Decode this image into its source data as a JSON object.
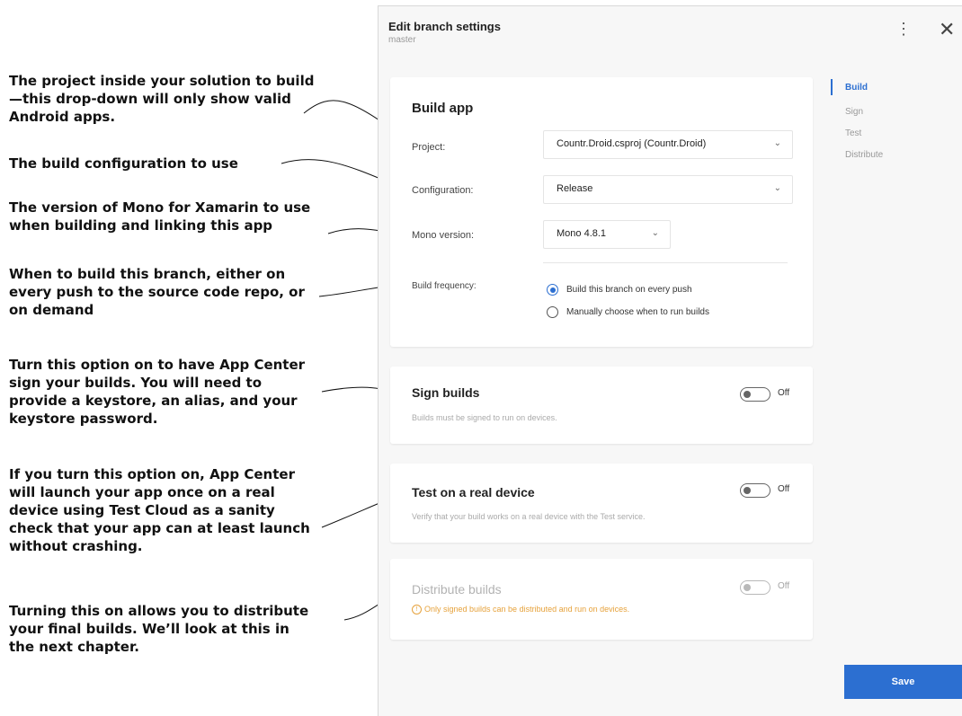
{
  "header": {
    "title": "Edit branch settings",
    "subtitle": "master",
    "more_icon": "⋮",
    "close_icon": "✕"
  },
  "nav": {
    "items": [
      "Build",
      "Sign",
      "Test",
      "Distribute"
    ],
    "active": "Build"
  },
  "build_app": {
    "title": "Build app",
    "project_label": "Project:",
    "project_value": "Countr.Droid.csproj (Countr.Droid)",
    "configuration_label": "Configuration:",
    "configuration_value": "Release",
    "mono_label": "Mono version:",
    "mono_value": "Mono 4.8.1",
    "frequency_label": "Build frequency:",
    "frequency_options": [
      "Build this branch on every push",
      "Manually choose when to run builds"
    ],
    "frequency_selected": "Build this branch on every push"
  },
  "sign_builds": {
    "title": "Sign builds",
    "description": "Builds must be signed to run on devices.",
    "toggle": "Off"
  },
  "test_device": {
    "title": "Test on a real device",
    "description": "Verify that your build works on a real device with the Test service.",
    "toggle": "Off"
  },
  "distribute": {
    "title": "Distribute builds",
    "warning": "Only signed builds can be distributed and run on devices.",
    "toggle": "Off"
  },
  "save_label": "Save",
  "annotations": [
    "The project inside your solution to build—this drop-down will only show valid Android apps.",
    "The build configuration to use",
    "The version of Mono for Xamarin to use when building and linking this app",
    "When to build this branch, either on every push to the source code repo, or on demand",
    "Turn this option on to have App Center sign your builds. You will need to provide a keystore, an alias, and your keystore password.",
    "If you turn this option on, App Center will launch your app once on a real device using Test Cloud as a sanity check that your app can at least launch without crashing.",
    "Turning this on allows you to distribute your final builds. We’ll look at this in the next chapter."
  ],
  "colors": {
    "accent": "#2c6fd1",
    "warning": "#e6a23c",
    "panel_bg": "#f7f7f7"
  }
}
